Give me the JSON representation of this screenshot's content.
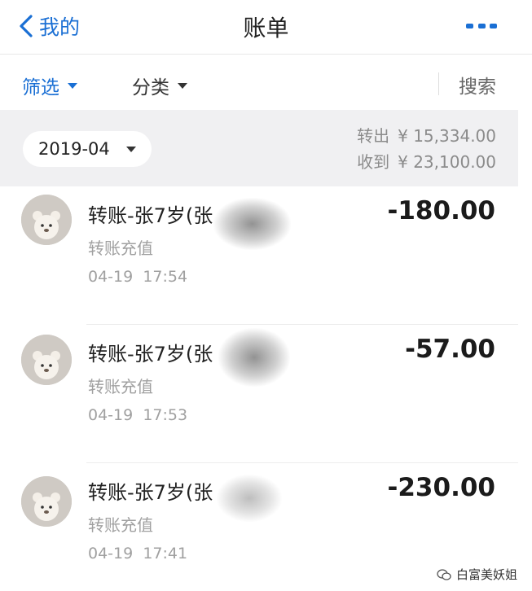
{
  "nav": {
    "back_label": "我的",
    "title": "账单"
  },
  "filters": {
    "filter_label": "筛选",
    "category_label": "分类",
    "search_label": "搜索"
  },
  "summary": {
    "month": "2019-04",
    "out_label": "转出",
    "out_value": "¥ 15,334.00",
    "in_label": "收到",
    "in_value": "¥ 23,100.00"
  },
  "transactions": [
    {
      "name": "转账-张7岁(张",
      "subtitle": "转账充值",
      "date": "04-19",
      "time": "17:54",
      "amount": "-180.00"
    },
    {
      "name": "转账-张7岁(张",
      "subtitle": "转账充值",
      "date": "04-19",
      "time": "17:53",
      "amount": "-57.00"
    },
    {
      "name": "转账-张7岁(张",
      "subtitle": "转账充值",
      "date": "04-19",
      "time": "17:41",
      "amount": "-230.00"
    }
  ],
  "watermark": {
    "text": "白富美妖姐"
  },
  "colors": {
    "accent": "#1a6fd4",
    "summary_bg": "#f0f0f2"
  }
}
